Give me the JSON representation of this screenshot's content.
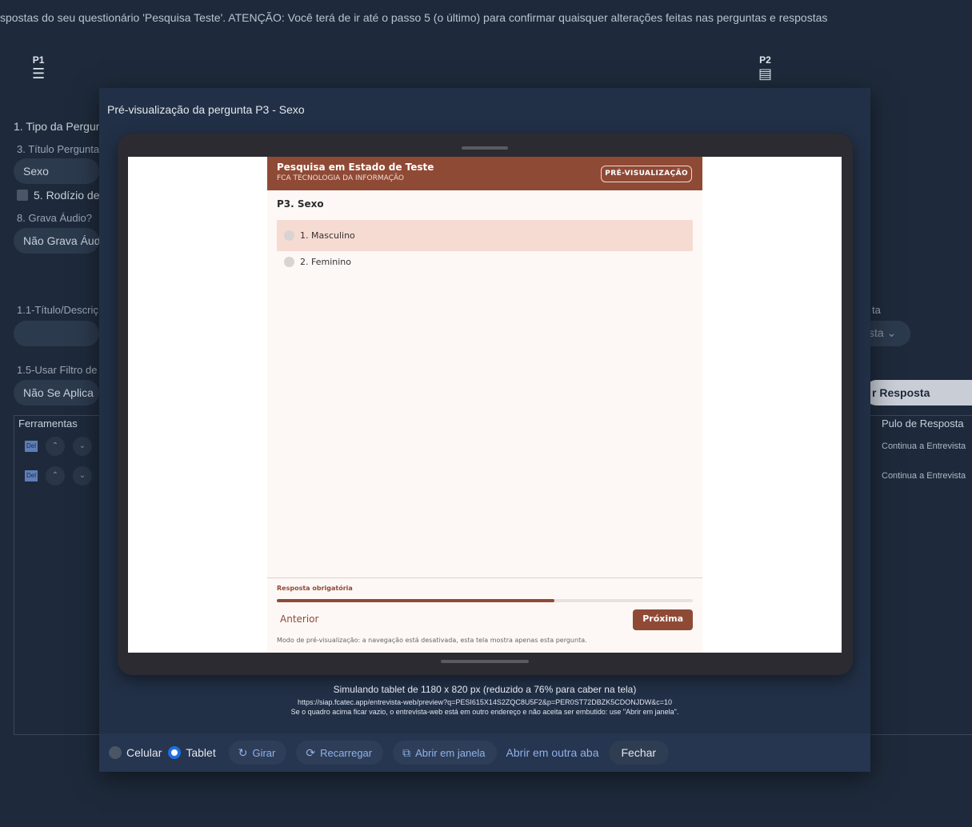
{
  "background": {
    "banner": "spostas do seu questionário 'Pesquisa Teste'. ATENÇÃO: Você terá de ir até o passo 5 (o último) para confirmar quaisquer alterações feitas nas perguntas e respostas",
    "steps": [
      {
        "label": "P1",
        "icon": "list-icon"
      },
      {
        "label": "P2",
        "icon": "card-list-icon"
      }
    ],
    "section_title": "1. Tipo da Pergun",
    "title_label": "3. Título Pergunta",
    "title_value": "Sexo",
    "rodizio_label": "5. Rodízio de",
    "grava_label": "8. Grava Áudio?",
    "grava_value": "Não Grava Áud",
    "titulo_desc_label": "1.1-Título/Descriç",
    "filtro_label": "1.5-Usar Filtro de",
    "filtro_value": "Não Se Aplica",
    "right_label": "ta",
    "right_select": "sta",
    "add_response_button": "r Resposta",
    "table": {
      "col_tools": "Ferramentas",
      "col_pulo": "Pulo de Resposta",
      "del_icon_text": "Del",
      "rows": [
        {
          "pulo": "Continua a Entrevista"
        },
        {
          "pulo": "Continua a Entrevista"
        }
      ]
    }
  },
  "modal": {
    "title": "Pré-visualização da pergunta P3 - Sexo",
    "survey": {
      "title": "Pesquisa em Estado de Teste",
      "subtitle": "FCA TECNOLOGIA DA INFORMAÇÃO",
      "badge": "PRÉ-VISUALIZAÇÃO",
      "question": "P3. Sexo",
      "options": [
        "1. Masculino",
        "2. Feminino"
      ],
      "selected_index": 0,
      "required": "Resposta obrigatória",
      "progress_fraction": 0.667,
      "prev_label": "Anterior",
      "next_label": "Próxima",
      "note": "Modo de pré-visualização: a navegação está desativada, esta tela mostra apenas esta pergunta."
    },
    "sim_line1": "Simulando tablet de 1180 x 820 px (reduzido a 76% para caber na tela)",
    "sim_url": "https://siap.fcatec.app/entrevista-web/preview?q=PESI615X14S2ZQC8U5F2&p=PER0ST72DBZK5CDONJDW&c=10",
    "sim_line3": "Se o quadro acima ficar vazio, o entrevista-web está em outro endereço e não aceita ser embutido: use \"Abrir em janela\".",
    "device_options": [
      {
        "label": "Celular",
        "selected": false
      },
      {
        "label": "Tablet",
        "selected": true
      }
    ],
    "actions": {
      "rotate": "Girar",
      "reload": "Recarregar",
      "open_window": "Abrir em janela",
      "open_tab": "Abrir em outra aba",
      "close": "Fechar"
    },
    "colors": {
      "survey_brand": "#8f4a36",
      "selected_option_bg": "#f6dbd2",
      "link": "#8fb2e8",
      "radio_active": "#1f6fe0"
    }
  }
}
